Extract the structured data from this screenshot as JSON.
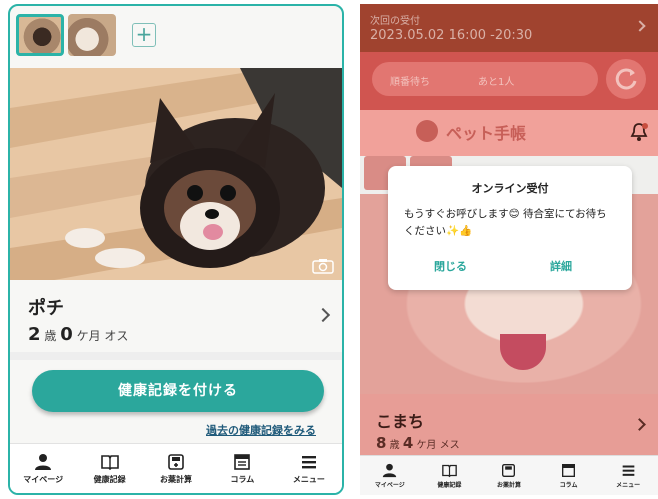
{
  "left": {
    "add_label": "+",
    "pet": {
      "name": "ポチ",
      "age_years": "2",
      "age_years_unit": "歳",
      "age_months": "0",
      "age_months_unit": "ケ月",
      "sex": "オス"
    },
    "record_button": "健康記録を付ける",
    "past_link": "過去の健康記録をみる",
    "tabs": [
      {
        "label": "マイページ",
        "icon": "person-icon"
      },
      {
        "label": "健康記録",
        "icon": "book-icon"
      },
      {
        "label": "お薬計算",
        "icon": "calculator-icon"
      },
      {
        "label": "コラム",
        "icon": "column-icon"
      },
      {
        "label": "メニュー",
        "icon": "menu-icon"
      }
    ]
  },
  "right": {
    "reception": {
      "title": "次回の受付",
      "datetime": "2023.05.02  16:00 -20:30"
    },
    "status": {
      "waiting_label": "順番待ち",
      "remaining": "あと1人"
    },
    "header_title": "ペット手帳",
    "pet": {
      "name": "こまち",
      "age_years": "8",
      "age_years_unit": "歳",
      "age_months": "4",
      "age_months_unit": "ケ月",
      "sex": "メス"
    },
    "modal": {
      "title": "オンライン受付",
      "message": "もうすぐお呼びします😊 待合室にてお待ちください✨👍",
      "close_label": "閉じる",
      "detail_label": "詳細"
    },
    "tabs": [
      {
        "label": "マイページ",
        "icon": "person-icon"
      },
      {
        "label": "健康記録",
        "icon": "book-icon"
      },
      {
        "label": "お薬計算",
        "icon": "calculator-icon"
      },
      {
        "label": "コラム",
        "icon": "column-icon"
      },
      {
        "label": "メニュー",
        "icon": "menu-icon"
      }
    ]
  },
  "colors": {
    "accent": "#2ba79c",
    "overlay_red": "#d05550"
  }
}
